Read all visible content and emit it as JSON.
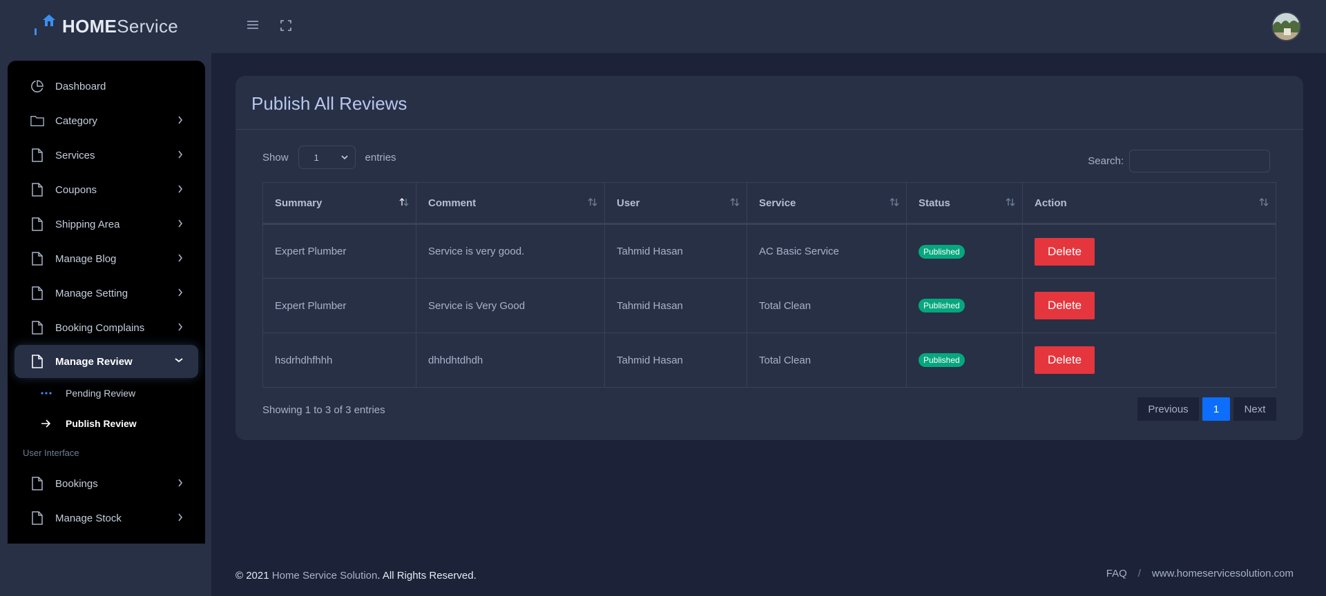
{
  "brand": {
    "bold": "HOME",
    "rest": "Service"
  },
  "sidebar": {
    "items": [
      {
        "label": "Dashboard",
        "icon": "pie-chart-icon",
        "has_chevron": false
      },
      {
        "label": "Category",
        "icon": "folder-icon",
        "has_chevron": true
      },
      {
        "label": "Services",
        "icon": "file-icon",
        "has_chevron": true
      },
      {
        "label": "Coupons",
        "icon": "file-icon",
        "has_chevron": true
      },
      {
        "label": "Shipping Area",
        "icon": "file-icon",
        "has_chevron": true
      },
      {
        "label": "Manage Blog",
        "icon": "file-icon",
        "has_chevron": true
      },
      {
        "label": "Manage Setting",
        "icon": "file-icon",
        "has_chevron": true
      },
      {
        "label": "Booking Complains",
        "icon": "file-icon",
        "has_chevron": true
      }
    ],
    "active": {
      "label": "Manage Review",
      "icon": "file-icon"
    },
    "subitems": [
      {
        "label": "Pending Review",
        "icon": "dots-icon"
      },
      {
        "label": "Publish Review",
        "icon": "arrow-right-icon"
      }
    ],
    "section_label": "User Interface",
    "section_items": [
      {
        "label": "Bookings",
        "icon": "file-icon"
      },
      {
        "label": "Manage Stock",
        "icon": "file-icon"
      }
    ]
  },
  "card": {
    "title": "Publish All Reviews",
    "show_label": "Show",
    "entries_value": "1",
    "entries_label": "entries",
    "search_label": "Search:",
    "search_value": ""
  },
  "table": {
    "headers": [
      "Summary",
      "Comment",
      "User",
      "Service",
      "Status",
      "Action"
    ],
    "rows": [
      {
        "summary": "Expert Plumber",
        "comment": "Service is very good.",
        "user": "Tahmid Hasan",
        "service": "AC Basic Service",
        "status": "Published",
        "action": "Delete"
      },
      {
        "summary": "Expert Plumber",
        "comment": "Service is Very Good",
        "user": "Tahmid Hasan",
        "service": "Total Clean",
        "status": "Published",
        "action": "Delete"
      },
      {
        "summary": "hsdrhdhfhhh",
        "comment": "dhhdhtdhdh",
        "user": "Tahmid Hasan",
        "service": "Total Clean",
        "status": "Published",
        "action": "Delete"
      }
    ],
    "info": "Showing 1 to 3 of 3 entries",
    "pagination": {
      "previous": "Previous",
      "current": "1",
      "next": "Next"
    }
  },
  "footer": {
    "copyright_prefix": "© 2021",
    "company": "Home Service Solution",
    "copyright_suffix": ". All Rights Reserved.",
    "faq": "FAQ",
    "separator": "/",
    "website": "www.homeservicesolution.com"
  },
  "colors": {
    "accent": "#0d6efd",
    "danger": "#e5363d",
    "success": "#06a77d",
    "sidebar": "#283046",
    "page": "#1c2238"
  }
}
